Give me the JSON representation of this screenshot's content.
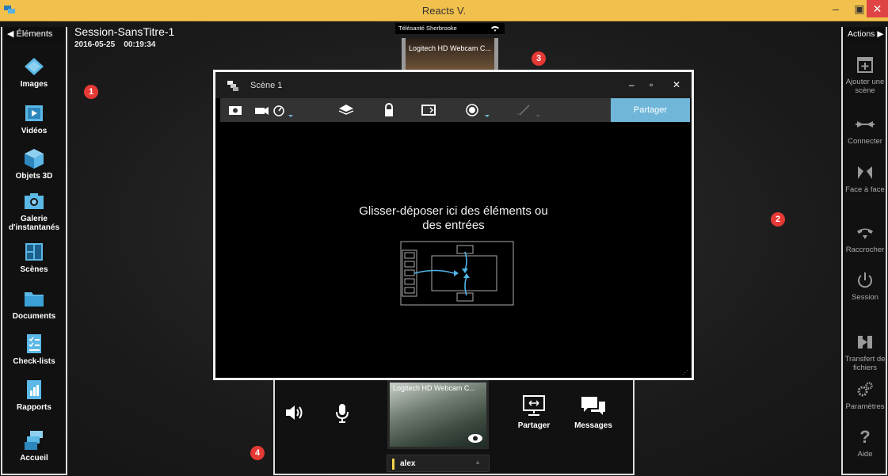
{
  "window": {
    "title": "Reacts V.",
    "controls": {
      "minimize": "–",
      "maximize": "▣",
      "close": "✕"
    }
  },
  "session": {
    "title": "Session-SansTitre-1",
    "date": "2016-05-25",
    "time": "00:19:34"
  },
  "left_panel": {
    "header": "◀ Éléments",
    "items": [
      {
        "label": "Images",
        "icon": "images-icon"
      },
      {
        "label": "Vidéos",
        "icon": "video-film-icon"
      },
      {
        "label": "Objets 3D",
        "icon": "cube-3d-icon"
      },
      {
        "label": "Galerie",
        "label2": "d'instantanés",
        "icon": "camera-icon"
      },
      {
        "label": "Scènes",
        "icon": "scenes-grid-icon"
      },
      {
        "label": "Documents",
        "icon": "folder-icon"
      },
      {
        "label": "Check-lists",
        "icon": "checklist-icon"
      },
      {
        "label": "Rapports",
        "icon": "report-chart-icon"
      },
      {
        "label": "Accueil",
        "icon": "home-stack-icon"
      }
    ]
  },
  "right_panel": {
    "header": "Actions ▶",
    "items": [
      {
        "label": "Ajouter une",
        "label2": "scène",
        "icon": "add-scene-icon"
      },
      {
        "label": "Connecter",
        "icon": "connect-icon"
      },
      {
        "label": "Face à face",
        "icon": "face-to-face-icon"
      },
      {
        "label": "Raccrocher",
        "icon": "hang-up-icon"
      },
      {
        "label": "Session",
        "icon": "power-icon"
      },
      {
        "label": "Transfert de",
        "label2": "fichiers",
        "icon": "file-transfer-icon"
      },
      {
        "label": "Paramètres",
        "icon": "gears-icon"
      },
      {
        "label": "Aide",
        "icon": "help-icon"
      }
    ]
  },
  "top_video": {
    "caller": "Télésanté Sherbrooke",
    "camera": "Logitech HD Webcam C..."
  },
  "badges": [
    "1",
    "2",
    "3",
    "4"
  ],
  "scene": {
    "title": "Scène 1",
    "share_label": "Partager",
    "drop_line1": "Glisser-déposer ici des éléments ou",
    "drop_line2": "des entrées"
  },
  "bottom": {
    "camera": "Logitech HD Webcam C...",
    "share_label": "Partager",
    "messages_label": "Messages",
    "user": "alex"
  },
  "colors": {
    "accent": "#6fb6d8",
    "titlebar": "#f2c04c",
    "badge": "#e53935",
    "close": "#e04343"
  }
}
